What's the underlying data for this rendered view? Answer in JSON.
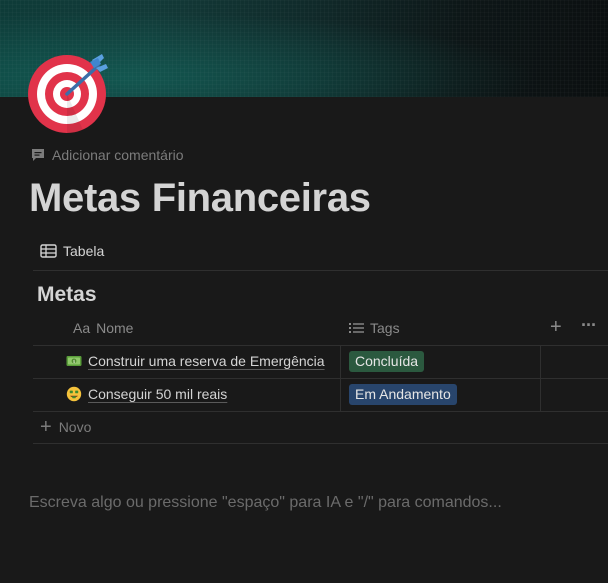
{
  "page": {
    "icon": "direct-hit-target-emoji",
    "add_comment_label": "Adicionar comentário",
    "title": "Metas Financeiras",
    "placeholder": "Escreva algo ou pressione \"espaço\" para IA e \"/\" para comandos..."
  },
  "view": {
    "tab_label": "Tabela",
    "tab_icon": "table-icon"
  },
  "database": {
    "title": "Metas",
    "columns": [
      {
        "label": "Nome",
        "icon": "text-aa-icon",
        "icon_text": "Aa"
      },
      {
        "label": "Tags",
        "icon": "list-icon"
      }
    ],
    "rows": [
      {
        "emoji": "money-banknote-emoji",
        "name": "Construir uma reserva de Emergência",
        "tag": "Concluída",
        "tag_color": "#2b593f"
      },
      {
        "emoji": "money-mouth-face-emoji",
        "name": "Conseguir 50 mil reais",
        "tag": "Em Andamento",
        "tag_color": "#28456c"
      }
    ],
    "new_label": "Novo"
  },
  "colors": {
    "background": "#191919",
    "text": "#d4d4d4",
    "muted": "#7c7c7c"
  }
}
